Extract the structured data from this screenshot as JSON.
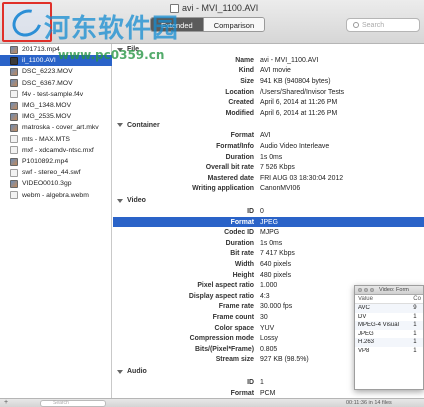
{
  "window": {
    "title": "avi - MVI_1100.AVI",
    "tabs": [
      {
        "label": "Extended",
        "active": true
      },
      {
        "label": "Comparison",
        "active": false
      }
    ],
    "search_placeholder": "Search",
    "accent_color": "#2a63c8"
  },
  "watermark": {
    "text": "河东软件园",
    "url": "www.pc0359.cn"
  },
  "sidebar": {
    "files": [
      {
        "name": "201713.mp4",
        "thumb": "img"
      },
      {
        "name": "il_1100.AVI",
        "thumb": "vid",
        "selected": true
      },
      {
        "name": "DSC_6223.MOV",
        "thumb": "img"
      },
      {
        "name": "DSC_6367.MOV",
        "thumb": "img"
      },
      {
        "name": "f4v - test-sample.f4v",
        "thumb": "doc"
      },
      {
        "name": "IMG_1348.MOV",
        "thumb": "img"
      },
      {
        "name": "IMG_2535.MOV",
        "thumb": "img"
      },
      {
        "name": "matroska - cover_art.mkv",
        "thumb": "img"
      },
      {
        "name": "mts - MAX.MTS",
        "thumb": "doc"
      },
      {
        "name": "mxf - xdcamdv-ntsc.mxf",
        "thumb": "doc"
      },
      {
        "name": "P1010892.mp4",
        "thumb": "img"
      },
      {
        "name": "swf - stereo_44.swf",
        "thumb": "doc"
      },
      {
        "name": "VIDEO0010.3gp",
        "thumb": "img"
      },
      {
        "name": "webm - algebra.webm",
        "thumb": "doc"
      }
    ]
  },
  "sections": {
    "file": "File",
    "container": "Container",
    "video": "Video",
    "audio": "Audio"
  },
  "file_props": [
    {
      "key": "Name",
      "value": "avi - MVI_1100.AVI"
    },
    {
      "key": "Kind",
      "value": "AVI movie"
    },
    {
      "key": "Size",
      "value": "941 KB (940804 bytes)"
    },
    {
      "key": "Location",
      "value": "/Users/Shared/Invisor Tests"
    },
    {
      "key": "Created",
      "value": "April 6, 2014 at 11:26 PM"
    },
    {
      "key": "Modified",
      "value": "April 6, 2014 at 11:26 PM"
    }
  ],
  "container_props": [
    {
      "key": "Format",
      "value": "AVI"
    },
    {
      "key": "Format/Info",
      "value": "Audio Video Interleave"
    },
    {
      "key": "Duration",
      "value": "1s 0ms"
    },
    {
      "key": "Overall bit rate",
      "value": "7 526 Kbps"
    },
    {
      "key": "Mastered date",
      "value": "FRI AUG 03 18:30:04 2012"
    },
    {
      "key": "Writing application",
      "value": "CanonMVI06"
    }
  ],
  "video_props": [
    {
      "key": "ID",
      "value": "0"
    },
    {
      "key": "Format",
      "value": "JPEG",
      "selected": true
    },
    {
      "key": "Codec ID",
      "value": "MJPG"
    },
    {
      "key": "Duration",
      "value": "1s 0ms"
    },
    {
      "key": "Bit rate",
      "value": "7 417 Kbps"
    },
    {
      "key": "Width",
      "value": "640 pixels"
    },
    {
      "key": "Height",
      "value": "480 pixels"
    },
    {
      "key": "Pixel aspect ratio",
      "value": "1.000"
    },
    {
      "key": "Display aspect ratio",
      "value": "4:3"
    },
    {
      "key": "Frame rate",
      "value": "30.000 fps"
    },
    {
      "key": "Frame count",
      "value": "30"
    },
    {
      "key": "Color space",
      "value": "YUV"
    },
    {
      "key": "Compression mode",
      "value": "Lossy"
    },
    {
      "key": "Bits/(Pixel*Frame)",
      "value": "0.805"
    },
    {
      "key": "Stream size",
      "value": "927 KB (98.5%)"
    }
  ],
  "audio_props": [
    {
      "key": "ID",
      "value": "1"
    },
    {
      "key": "Format",
      "value": "PCM"
    },
    {
      "key": "Format settings, Endianness",
      "value": "Little"
    }
  ],
  "float_window": {
    "title": "Video: Form",
    "col1": "Value",
    "col2": "Co",
    "rows": [
      {
        "value": "AVC",
        "count": "9"
      },
      {
        "value": "DV",
        "count": "1"
      },
      {
        "value": "MPEG-4 Visual",
        "count": "1"
      },
      {
        "value": "JPEG",
        "count": "1"
      },
      {
        "value": "H.263",
        "count": "1"
      },
      {
        "value": "VP8",
        "count": "1"
      }
    ]
  },
  "bottom": {
    "search_placeholder": "Search",
    "status": "00:11:36 in 14 files"
  }
}
